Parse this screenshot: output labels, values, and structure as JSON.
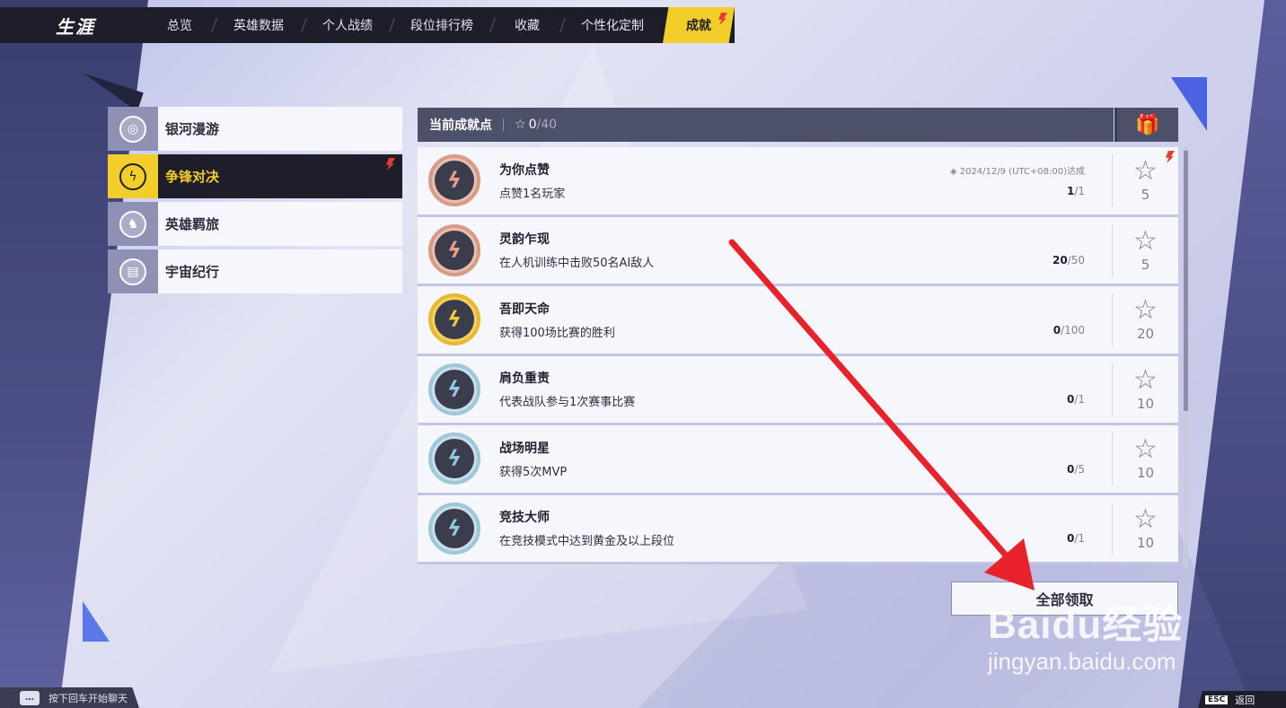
{
  "topbar": {
    "title": "生涯",
    "tabs": [
      {
        "label": "总览",
        "active": false
      },
      {
        "label": "英雄数据",
        "active": false
      },
      {
        "label": "个人战绩",
        "active": false
      },
      {
        "label": "段位排行榜",
        "active": false
      },
      {
        "label": "收藏",
        "active": false
      },
      {
        "label": "个性化定制",
        "active": false
      },
      {
        "label": "成就",
        "active": true
      }
    ]
  },
  "categories": [
    {
      "label": "银河漫游",
      "icon": "galaxy-icon",
      "active": false
    },
    {
      "label": "争锋对决",
      "icon": "versus-icon",
      "active": true
    },
    {
      "label": "英雄羁旅",
      "icon": "hero-icon",
      "active": false
    },
    {
      "label": "宇宙纪行",
      "icon": "book-icon",
      "active": false
    }
  ],
  "points": {
    "title": "当前成就点",
    "current": "0",
    "total": "/40"
  },
  "achievements": [
    {
      "name": "为你点赞",
      "desc": "点赞1名玩家",
      "date": "◈ 2024/12/9 (UTC+08:00)达成",
      "progress": "1",
      "goal": "/1",
      "points": "5",
      "medal": "bronze",
      "badge": true
    },
    {
      "name": "灵韵乍现",
      "desc": "在人机训练中击败50名AI敌人",
      "date": "",
      "progress": "20",
      "goal": "/50",
      "points": "5",
      "medal": "bronze",
      "badge": false
    },
    {
      "name": "吾即天命",
      "desc": "获得100场比赛的胜利",
      "date": "",
      "progress": "0",
      "goal": "/100",
      "points": "20",
      "medal": "gold",
      "badge": false
    },
    {
      "name": "肩负重责",
      "desc": "代表战队参与1次赛事比赛",
      "date": "",
      "progress": "0",
      "goal": "/1",
      "points": "10",
      "medal": "silver",
      "badge": false
    },
    {
      "name": "战场明星",
      "desc": "获得5次MVP",
      "date": "",
      "progress": "0",
      "goal": "/5",
      "points": "10",
      "medal": "silver",
      "badge": false
    },
    {
      "name": "竞技大师",
      "desc": "在竞技模式中达到黄金及以上段位",
      "date": "",
      "progress": "0",
      "goal": "/1",
      "points": "10",
      "medal": "silver",
      "badge": false
    }
  ],
  "claim_all_label": "全部领取",
  "chat_hint": "按下回车开始聊天",
  "esc": {
    "key": "ESC",
    "label": "返回"
  },
  "watermark": {
    "brand": "Baidu经验",
    "url": "jingyan.baidu.com"
  },
  "colors": {
    "accent": "#f3ce2a",
    "dark": "#1d1e2a",
    "alert": "#e63b2e",
    "arrow": "#e8212b"
  }
}
